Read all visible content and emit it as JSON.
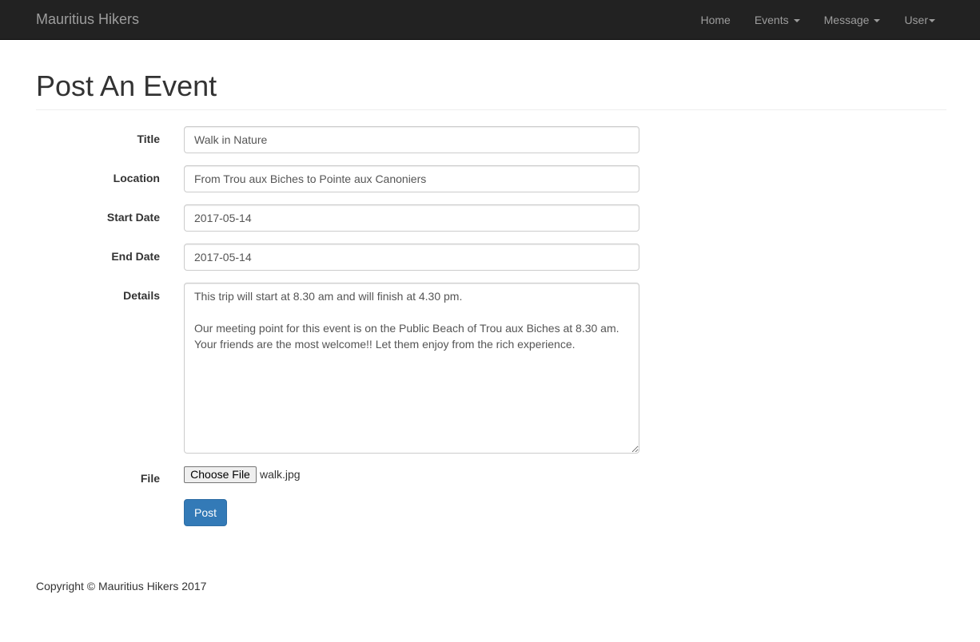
{
  "navbar": {
    "brand": "Mauritius Hikers",
    "items": [
      {
        "label": "Home"
      },
      {
        "label": "Events"
      },
      {
        "label": "Message"
      },
      {
        "label": "User"
      }
    ]
  },
  "page": {
    "title": "Post An Event"
  },
  "form": {
    "title": {
      "label": "Title",
      "value": "Walk in Nature"
    },
    "location": {
      "label": "Location",
      "value": "From Trou aux Biches to Pointe aux Canoniers"
    },
    "start_date": {
      "label": "Start Date",
      "value": "2017-05-14"
    },
    "end_date": {
      "label": "End Date",
      "value": "2017-05-14"
    },
    "details": {
      "label": "Details",
      "value": "This trip will start at 8.30 am and will finish at 4.30 pm.\n\nOur meeting point for this event is on the Public Beach of Trou aux Biches at 8.30 am.\nYour friends are the most welcome!! Let them enjoy from the rich experience."
    },
    "file": {
      "label": "File",
      "button_label": "Choose File",
      "filename": "walk.jpg"
    },
    "submit_label": "Post"
  },
  "footer": {
    "copyright": "Copyright © Mauritius Hikers 2017"
  },
  "colors": {
    "navbar_bg": "#222222",
    "navbar_text": "#9d9d9d",
    "primary": "#337ab7"
  }
}
